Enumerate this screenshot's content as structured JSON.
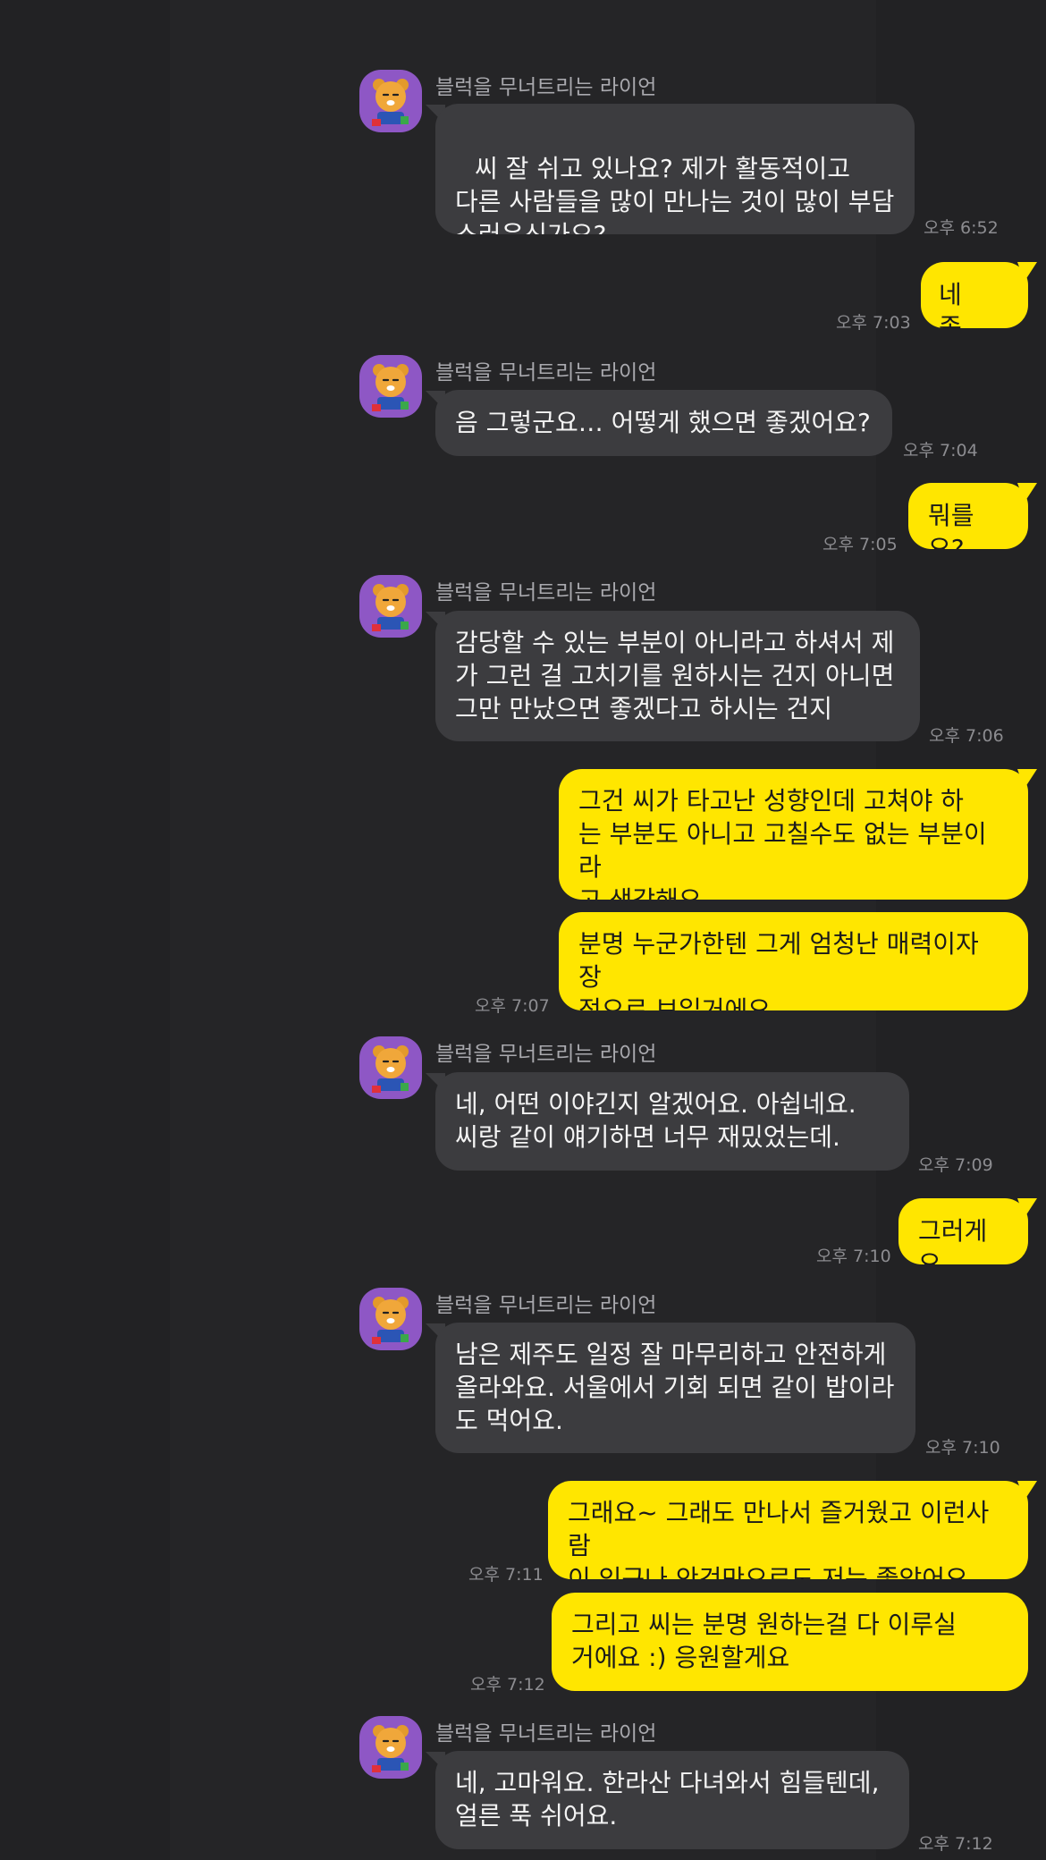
{
  "chat": {
    "sender_name": "블럭을 무너트리는 라이언",
    "colors": {
      "background": "#222224",
      "incoming_bubble": "#3c3c3f",
      "outgoing_bubble": "#ffe600",
      "avatar_bg": "#8e57c5"
    },
    "avatar_icon": "ryan-character-icon",
    "messages": [
      {
        "text": "씨 잘 쉬고 있나요? 제가 활동적이고\n다른 사람들을 많이 만나는 것이 많이 부담\n스러운신가요?",
        "time": "오후 6:52"
      },
      {
        "text": "네 좀..",
        "time": "오후 7:03"
      },
      {
        "text": "음 그렇군요… 어떻게 했으면 좋겠어요?",
        "time": "오후 7:04"
      },
      {
        "text": "뭐를요?",
        "time": "오후 7:05"
      },
      {
        "text": "감당할 수 있는 부분이 아니라고 하셔서 제\n가 그런 걸 고치기를 원하시는 건지 아니면\n그만 만났으면 좋겠다고 하시는 건지",
        "time": "오후 7:06"
      },
      {
        "text": "그건 씨가 타고난 성향인데 고쳐야 하\n는 부분도 아니고 고칠수도 없는 부분이라\n고 생각해요"
      },
      {
        "text": "분명 누군가한텐 그게 엄청난 매력이자 장\n점으로 보일거에요",
        "time": "오후 7:07"
      },
      {
        "text": "네, 어떤 이야긴지 알겠어요. 아쉽네요.\n씨랑 같이 얘기하면 너무 재밌었는데.",
        "time": "오후 7:09"
      },
      {
        "text": "그러게요",
        "time": "오후 7:10"
      },
      {
        "text": "남은 제주도 일정 잘 마무리하고 안전하게\n올라와요. 서울에서 기회 되면 같이 밥이라\n도 먹어요.",
        "time": "오후 7:10"
      },
      {
        "text": "그래요~ 그래도 만나서 즐거웠고 이런사람\n이 있구나 안것만으로도 저는 좋았어요",
        "time": "오후 7:11"
      },
      {
        "text": "그리고 씨는 분명 원하는걸 다 이루실\n거에요 :) 응원할게요",
        "time": "오후 7:12"
      },
      {
        "text": "네, 고마워요. 한라산 다녀와서 힘들텐데,\n얼른 푹 쉬어요.",
        "time": "오후 7:12"
      }
    ]
  }
}
